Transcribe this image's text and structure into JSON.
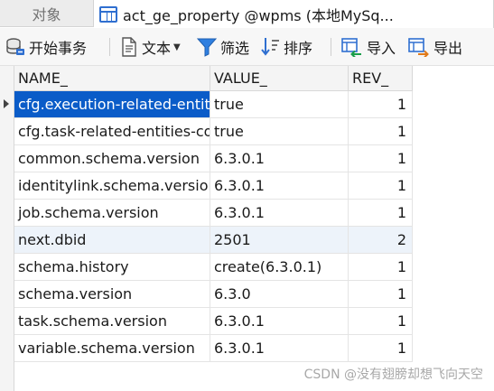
{
  "tabs": {
    "objects_label": "对象",
    "active_label": "act_ge_property @wpms (本地MySq..."
  },
  "toolbar": {
    "begin_transaction": "开始事务",
    "text": "文本",
    "filter": "筛选",
    "sort": "排序",
    "import": "导入",
    "export": "导出"
  },
  "grid": {
    "columns": [
      "NAME_",
      "VALUE_",
      "REV_"
    ],
    "rows": [
      {
        "name": "cfg.execution-related-entities-count",
        "value": "true",
        "rev": "1"
      },
      {
        "name": "cfg.task-related-entities-count",
        "value": "true",
        "rev": "1"
      },
      {
        "name": "common.schema.version",
        "value": "6.3.0.1",
        "rev": "1"
      },
      {
        "name": "identitylink.schema.version",
        "value": "6.3.0.1",
        "rev": "1"
      },
      {
        "name": "job.schema.version",
        "value": "6.3.0.1",
        "rev": "1"
      },
      {
        "name": "next.dbid",
        "value": "2501",
        "rev": "2"
      },
      {
        "name": "schema.history",
        "value": "create(6.3.0.1)",
        "rev": "1"
      },
      {
        "name": "schema.version",
        "value": "6.3.0",
        "rev": "1"
      },
      {
        "name": "task.schema.version",
        "value": "6.3.0.1",
        "rev": "1"
      },
      {
        "name": "variable.schema.version",
        "value": "6.3.0.1",
        "rev": "1"
      }
    ]
  },
  "watermark": "CSDN @没有翅膀却想飞向天空",
  "colors": {
    "selection": "#0a5cc8",
    "accent_blue": "#2f6fd0",
    "header_bg": "#f4f4f4"
  }
}
